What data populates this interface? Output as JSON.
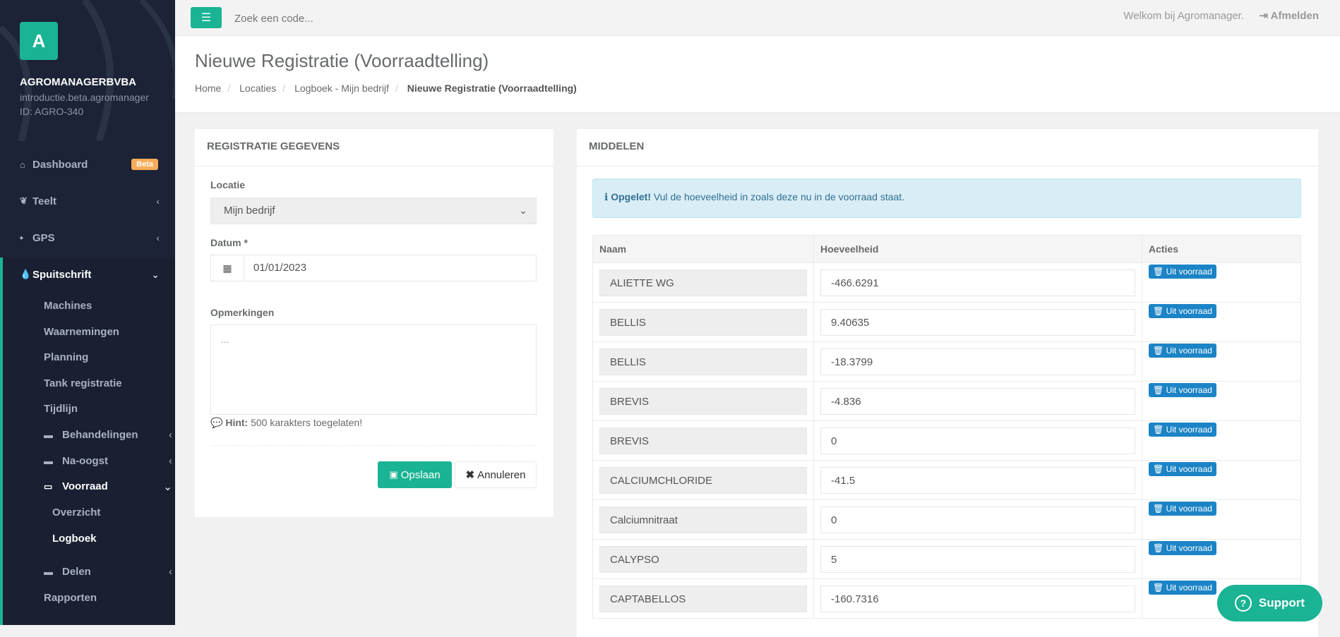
{
  "sidebar": {
    "logo_letter": "A",
    "company": "AGROMANAGERBVBA",
    "subdomain": "introductie.beta.agromanager",
    "company_id": "ID: AGRO-340",
    "dashboard": "Dashboard",
    "beta_badge": "Beta",
    "teelt": "Teelt",
    "gps": "GPS",
    "spuitschrift": "Spuitschrift",
    "sub": [
      "Machines",
      "Waarnemingen",
      "Planning",
      "Tank registratie",
      "Tijdlijn"
    ],
    "behandelingen": "Behandelingen",
    "na_oogst": "Na-oogst",
    "voorraad": "Voorraad",
    "overzicht": "Overzicht",
    "logboek": "Logboek",
    "delen": "Delen",
    "rapporten": "Rapporten"
  },
  "topbar": {
    "search_placeholder": "Zoek een code...",
    "welcome": "Welkom bij Agromanager.",
    "logout": "Afmelden"
  },
  "header": {
    "title": "Nieuwe Registratie (Voorraadtelling)",
    "breadcrumb": [
      "Home",
      "Locaties",
      "Logboek - Mijn bedrijf",
      "Nieuwe Registratie (Voorraadtelling)"
    ]
  },
  "form": {
    "panel_title": "REGISTRATIE GEGEVENS",
    "locatie_label": "Locatie",
    "locatie_value": "Mijn bedrijf",
    "datum_label": "Datum *",
    "datum_value": "01/01/2023",
    "opmerkingen_label": "Opmerkingen",
    "opmerkingen_placeholder": "...",
    "hint_label": "Hint:",
    "hint_text": "500 karakters toegelaten!",
    "save": "Opslaan",
    "cancel": "Annuleren"
  },
  "middelen": {
    "panel_title": "MIDDELEN",
    "alert_strong": "Opgelet!",
    "alert_text": "Vul de hoeveelheid in zoals deze nu in de voorraad staat.",
    "columns": [
      "Naam",
      "Hoeveelheid",
      "Acties"
    ],
    "action_label": "Uit voorraad",
    "rows": [
      {
        "name": "ALIETTE WG",
        "qty": "-466.6291"
      },
      {
        "name": "BELLIS",
        "qty": "9.40635"
      },
      {
        "name": "BELLIS",
        "qty": "-18.3799"
      },
      {
        "name": "BREVIS",
        "qty": "-4.836"
      },
      {
        "name": "BREVIS",
        "qty": "0"
      },
      {
        "name": "CALCIUMCHLORIDE",
        "qty": "-41.5"
      },
      {
        "name": "Calciumnitraat",
        "qty": "0"
      },
      {
        "name": "CALYPSO",
        "qty": "5"
      },
      {
        "name": "CAPTABELLOS",
        "qty": "-160.7316"
      }
    ]
  },
  "support": {
    "label": "Support"
  },
  "colors": {
    "accent": "#1ab394",
    "sidebar": "#1c2336",
    "action_blue": "#1c84c6",
    "beta": "#f8ac59"
  }
}
